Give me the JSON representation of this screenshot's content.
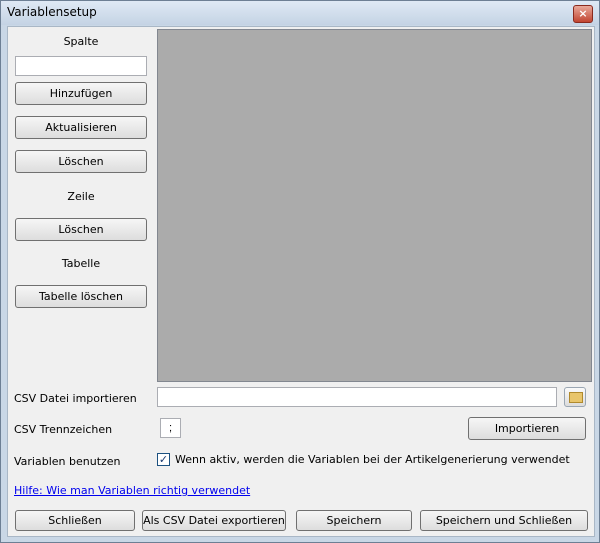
{
  "window": {
    "title": "Variablensetup",
    "close_label": "×"
  },
  "left_panel": {
    "spalte_label": "Spalte",
    "spalte_input_value": "",
    "hinzufuegen_label": "Hinzufügen",
    "aktualisieren_label": "Aktualisieren",
    "loeschen_spalte_label": "Löschen",
    "zeile_label": "Zeile",
    "loeschen_zeile_label": "Löschen",
    "tabelle_label": "Tabelle",
    "tabelle_loeschen_label": "Tabelle löschen"
  },
  "csv": {
    "import_label": "CSV Datei importieren",
    "import_path_value": "",
    "separator_label": "CSV Trennzeichen",
    "separator_value": ";",
    "import_button_label": "Importieren"
  },
  "variables": {
    "use_label": "Variablen benutzen",
    "checkbox_checked": true,
    "checkbox_mark": "✓",
    "checkbox_text": "Wenn aktiv, werden die Variablen bei der Artikelgenerierung verwendet"
  },
  "help_link": "Hilfe: Wie man Variablen richtig verwendet",
  "footer": {
    "close_label": "Schließen",
    "export_label": "Als CSV Datei exportieren",
    "save_label": "Speichern",
    "save_close_label": "Speichern und Schließen"
  },
  "icons": {
    "browse": "folder-browse-icon"
  }
}
